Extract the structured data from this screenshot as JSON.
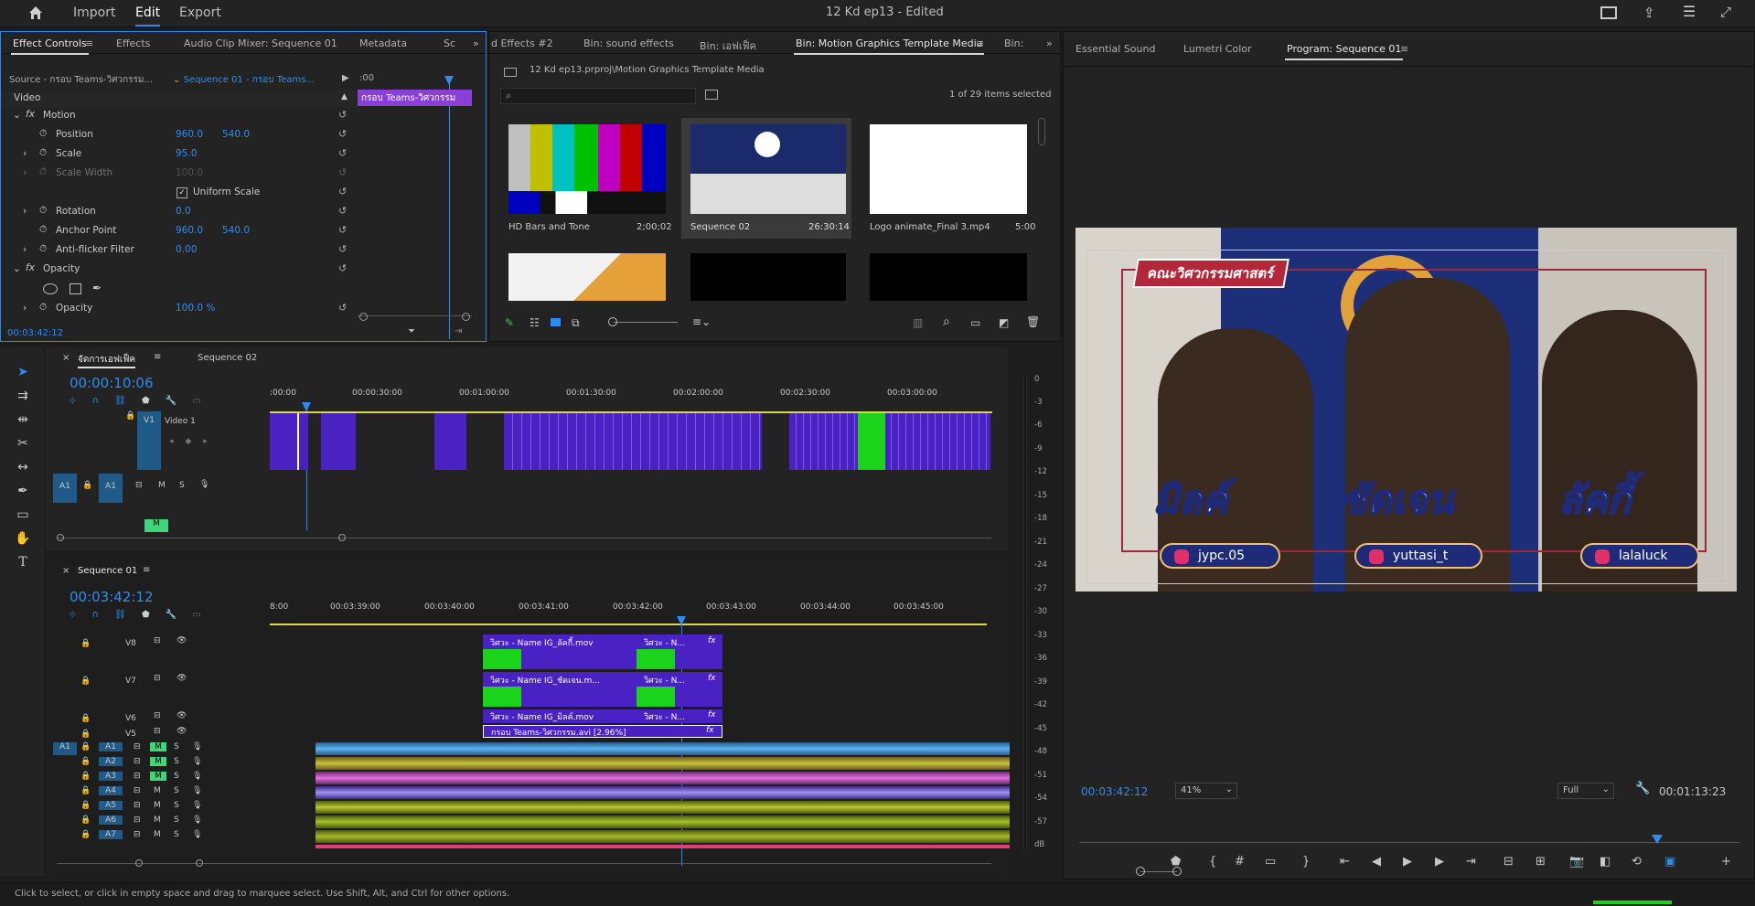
{
  "topbar": {
    "home_icon": "home-icon",
    "nav": [
      "Import",
      "Edit",
      "Export"
    ],
    "active": "Edit",
    "title": "12 Kd ep13",
    "edited": " - Edited"
  },
  "effect_controls": {
    "tabs": [
      "Effect Controls",
      "Effects",
      "Audio Clip Mixer: Sequence 01",
      "Metadata",
      "Sc"
    ],
    "source": "Source - กรอบ Teams-วิศวกรรม...",
    "sequence": "Sequence 01 - กรอบ Teams...",
    "ruler_start": ":00",
    "clip_label": "กรอบ Teams-วิศวกรรม",
    "video_header": "Video",
    "motion": "Motion",
    "position_label": "Position",
    "position_x": "960.0",
    "position_y": "540.0",
    "scale_label": "Scale",
    "scale": "95.0",
    "scale_width_label": "Scale Width",
    "scale_width": "100.0",
    "uniform_scale": "Uniform Scale",
    "rotation_label": "Rotation",
    "rotation": "0.0",
    "anchor_label": "Anchor Point",
    "anchor_x": "960.0",
    "anchor_y": "540.0",
    "antiflicker_label": "Anti-flicker Filter",
    "antiflicker": "0.00",
    "opacity_header": "Opacity",
    "opacity_label": "Opacity",
    "opacity": "100.0 %",
    "timecode": "00:03:42:12"
  },
  "bin": {
    "tabs": [
      "d Effects #2",
      "Bin: sound effects",
      "Bin: เอฟเฟ็ค",
      "Bin: Motion Graphics Template Media",
      "Bin:"
    ],
    "path": "12 Kd ep13.prproj\\Motion Graphics Template Media",
    "count": "1 of 29 items selected",
    "items": [
      {
        "name": "HD Bars and Tone",
        "dur": "2;00;02"
      },
      {
        "name": "Sequence 02",
        "dur": "26:30:14"
      },
      {
        "name": "Logo animate_Final 3.mp4",
        "dur": "5:00"
      }
    ]
  },
  "program": {
    "tabs": [
      "Essential Sound",
      "Lumetri Color",
      "Program: Sequence 01"
    ],
    "timecode": "00:03:42:12",
    "zoom": "41%",
    "quality": "Full",
    "duration": "00:01:13:23",
    "banner": "คณะวิศวกรรมศาสตร์",
    "names": [
      {
        "name": "มิลค์",
        "ig": "jypc.05"
      },
      {
        "name": "ชัดเจน",
        "ig": "yuttasi_t"
      },
      {
        "name": "ลัคกี้",
        "ig": "lalaluck"
      }
    ]
  },
  "timeline_top": {
    "tabs": [
      "จัดการเอฟเฟ็ค",
      "Sequence 02"
    ],
    "timecode": "00:00:10:06",
    "ruler": [
      ":00:00",
      "00:00:30:00",
      "00:01:00:00",
      "00:01:30:00",
      "00:02:00:00",
      "00:02:30:00",
      "00:03:00:00"
    ],
    "v1": "V1",
    "video1": "Video 1",
    "a1": "A1",
    "m": "M",
    "s": "S"
  },
  "timeline_bottom": {
    "tab": "Sequence 01",
    "timecode": "00:03:42:12",
    "ruler": [
      "8:00",
      "00:03:39:00",
      "00:03:40:00",
      "00:03:41:00",
      "00:03:42:00",
      "00:03:43:00",
      "00:03:44:00",
      "00:03:45:00"
    ],
    "tracks": [
      "V8",
      "V7",
      "V6",
      "V5"
    ],
    "clip_v8": "วิศวะ - Name IG_ลัคกี้.mov",
    "clip_v8b": "วิศวะ - N...",
    "clip_v7": "วิศวะ - Name IG_ชัดเจน.m...",
    "clip_v7b": "วิศวะ - N...",
    "clip_v6": "วิศวะ - Name IG_มิลค์.mov",
    "clip_v6b": "วิศวะ - N...",
    "clip_v5": "กรอบ Teams-วิศวกรรม.avi [2.96%]",
    "audio_tracks": [
      "A1",
      "A2",
      "A3",
      "A4",
      "A5",
      "A6",
      "A7"
    ],
    "fx": "fx"
  },
  "meter": [
    "0",
    "-3",
    "-6",
    "-9",
    "-12",
    "-15",
    "-18",
    "-21",
    "-24",
    "-27",
    "-30",
    "-33",
    "-36",
    "-39",
    "-42",
    "-45",
    "-48",
    "-51",
    "-54",
    "-57",
    "dB"
  ],
  "status": "Click to select, or click in empty space and drag to marquee select. Use Shift, Alt, and Ctrl for other options.",
  "colors": {
    "accent": "#2e8cf0",
    "clip": "#4a22c4",
    "green": "#1bd31b",
    "audio_blue": "#5ab4ee",
    "audio_yellow": "#c8c23a",
    "audio_pink": "#e070e0"
  }
}
